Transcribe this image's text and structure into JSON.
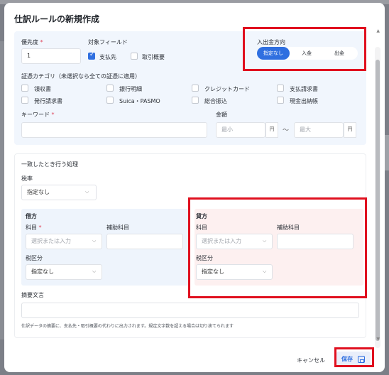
{
  "modal": {
    "title": "仕訳ルールの新規作成"
  },
  "priority": {
    "label": "優先度",
    "required": "*",
    "value": "1"
  },
  "target_field": {
    "label": "対象フィールド",
    "options": [
      {
        "label": "支払先",
        "checked": true
      },
      {
        "label": "取引概要",
        "checked": false
      }
    ]
  },
  "direction": {
    "label": "入出金方向",
    "options": [
      "指定なし",
      "入金",
      "出金"
    ],
    "selected": "指定なし"
  },
  "evidence": {
    "label": "証憑カテゴリ（未選択なら全ての証憑に適用）",
    "items": [
      "領収書",
      "銀行明細",
      "クレジットカード",
      "支払請求書",
      "発行請求書",
      "Suica・PASMO",
      "総合振込",
      "現金出納帳"
    ]
  },
  "keyword": {
    "label": "キーワード",
    "required": "*"
  },
  "amount": {
    "label": "金額",
    "min_placeholder": "最小",
    "max_placeholder": "最大",
    "unit": "円",
    "separator": "〜"
  },
  "match_section": {
    "title": "一致したとき行う処理",
    "tax_rate": {
      "label": "税率",
      "value": "指定なし"
    }
  },
  "debit": {
    "title": "借方",
    "account_label": "科目",
    "required": "*",
    "account_placeholder": "選択または入力",
    "sub_account_label": "補助科目",
    "tax_label": "税区分",
    "tax_value": "指定なし"
  },
  "credit": {
    "title": "貸方",
    "account_label": "科目",
    "account_placeholder": "選択または入力",
    "sub_account_label": "補助科目",
    "tax_label": "税区分",
    "tax_value": "指定なし"
  },
  "memo": {
    "label": "摘要文言",
    "help": "仕訳データの摘要に、支払先・取引概要の代わりに出力されます。規定文字数を超える場合は切り捨てられます"
  },
  "footer": {
    "cancel": "キャンセル",
    "save": "保存"
  },
  "colors": {
    "accent": "#2f6fe0",
    "highlight": "#e0101f",
    "debit_bg": "#eef4fc",
    "credit_bg": "#fdf0f0"
  }
}
